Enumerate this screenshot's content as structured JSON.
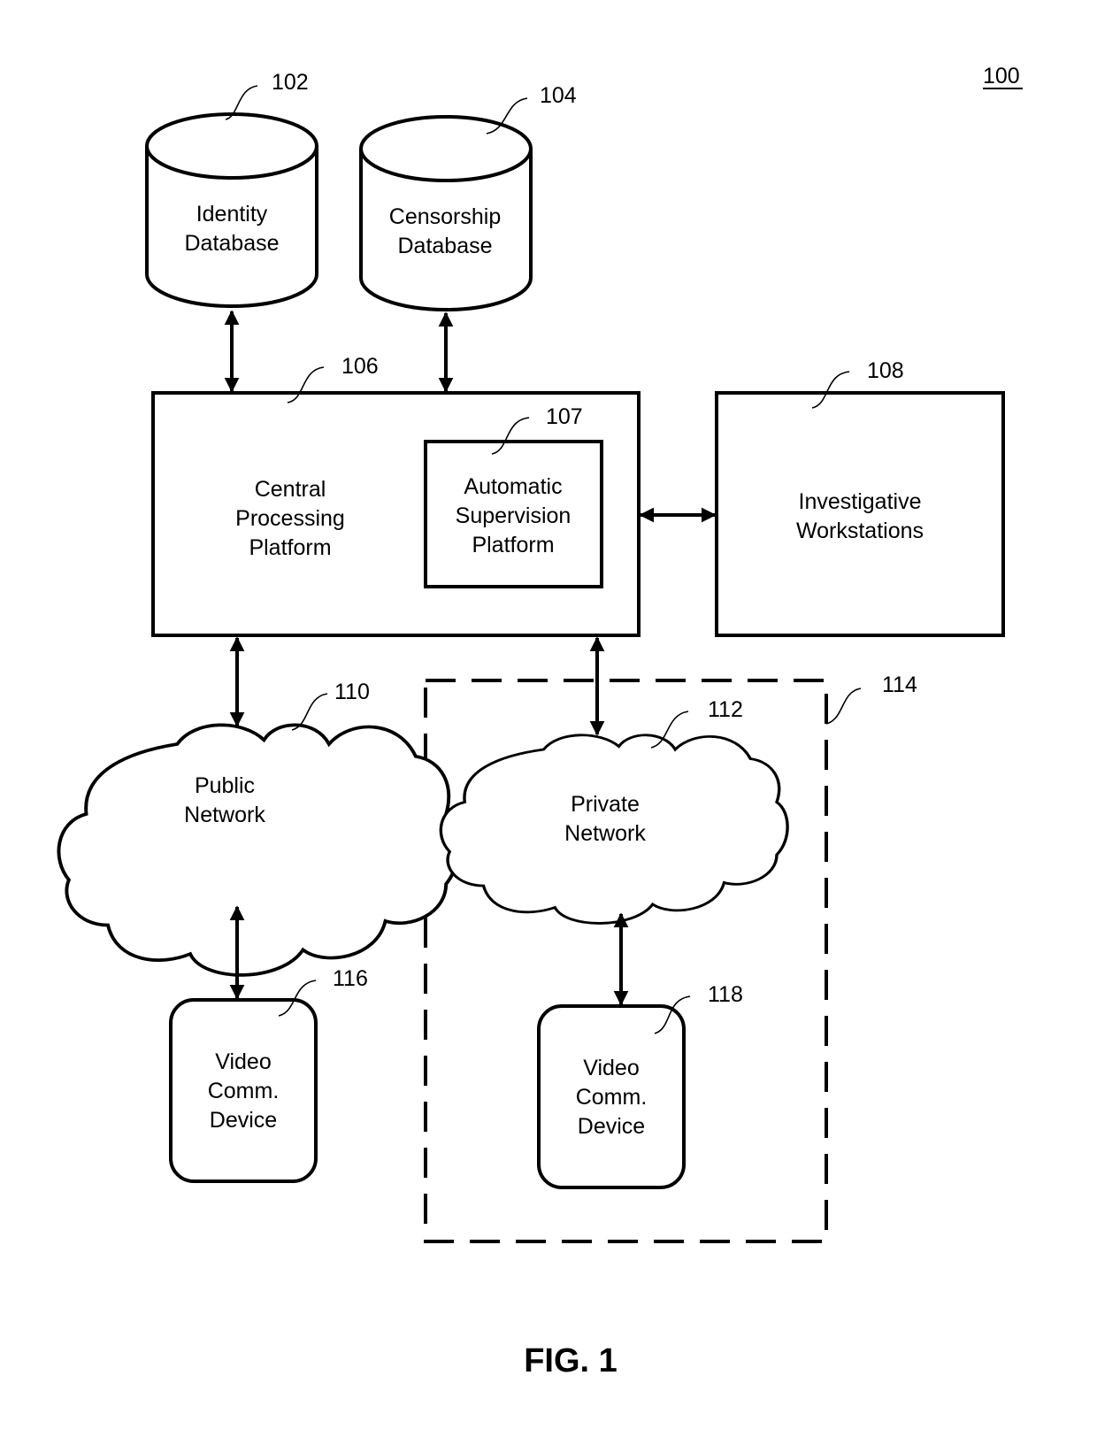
{
  "figure": {
    "title": "FIG. 1",
    "system_ref": "100"
  },
  "nodes": {
    "identity_db": {
      "ref": "102",
      "lines": [
        "Identity",
        "Database"
      ]
    },
    "censorship_db": {
      "ref": "104",
      "lines": [
        "Censorship",
        "Database"
      ]
    },
    "central_platform": {
      "ref": "106",
      "lines": [
        "Central",
        "Processing",
        "Platform"
      ]
    },
    "supervision_platform": {
      "ref": "107",
      "lines": [
        "Automatic",
        "Supervision",
        "Platform"
      ]
    },
    "investigative_ws": {
      "ref": "108",
      "lines": [
        "Investigative",
        "Workstations"
      ]
    },
    "public_network": {
      "ref": "110",
      "lines": [
        "Public",
        "Network"
      ]
    },
    "private_network": {
      "ref": "112",
      "lines": [
        "Private",
        "Network"
      ]
    },
    "controlled_env": {
      "ref": "114"
    },
    "device_public": {
      "ref": "116",
      "lines": [
        "Video",
        "Comm.",
        "Device"
      ]
    },
    "device_private": {
      "ref": "118",
      "lines": [
        "Video",
        "Comm.",
        "Device"
      ]
    }
  },
  "connections": [
    {
      "from": "identity_db",
      "to": "central_platform",
      "direction": "bidirectional"
    },
    {
      "from": "censorship_db",
      "to": "central_platform",
      "direction": "bidirectional"
    },
    {
      "from": "central_platform",
      "to": "investigative_ws",
      "direction": "bidirectional"
    },
    {
      "from": "central_platform",
      "to": "public_network",
      "direction": "bidirectional"
    },
    {
      "from": "central_platform",
      "to": "private_network",
      "direction": "bidirectional"
    },
    {
      "from": "public_network",
      "to": "device_public",
      "direction": "bidirectional"
    },
    {
      "from": "private_network",
      "to": "device_private",
      "direction": "bidirectional"
    }
  ],
  "colors": {
    "stroke": "#000000",
    "background": "#ffffff"
  }
}
